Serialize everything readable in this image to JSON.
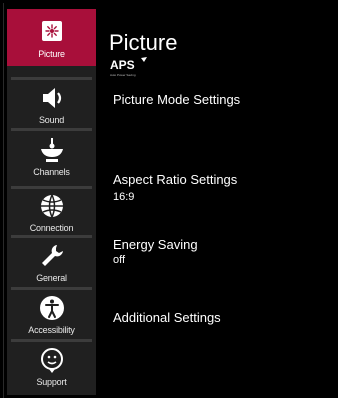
{
  "sidebar": {
    "items": [
      {
        "label": "Picture",
        "icon": "picture-icon",
        "active": true
      },
      {
        "label": "Sound",
        "icon": "speaker-icon",
        "active": false
      },
      {
        "label": "Channels",
        "icon": "antenna-icon",
        "active": false
      },
      {
        "label": "Connection",
        "icon": "globe-icon",
        "active": false
      },
      {
        "label": "General",
        "icon": "wrench-icon",
        "active": false
      },
      {
        "label": "Accessibility",
        "icon": "accessibility-icon",
        "active": false
      },
      {
        "label": "Support",
        "icon": "support-icon",
        "active": false
      }
    ],
    "active_color": "#a80f3a"
  },
  "panel": {
    "title": "Picture",
    "badge": "APS",
    "badge_sub": "Auto Power Saving",
    "rows": [
      {
        "name": "Picture Mode Settings",
        "value": ""
      },
      {
        "name": "Aspect Ratio Settings",
        "value": "16:9"
      },
      {
        "name": "Energy Saving",
        "value": "off"
      },
      {
        "name": "Additional Settings",
        "value": ""
      }
    ]
  }
}
